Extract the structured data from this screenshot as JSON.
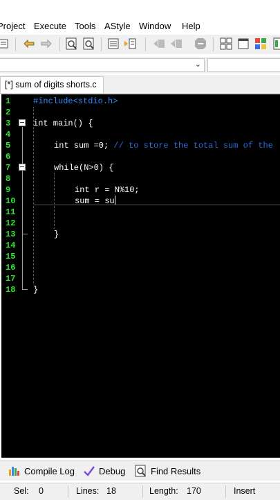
{
  "menu": [
    "Project",
    "Execute",
    "Tools",
    "AStyle",
    "Window",
    "Help"
  ],
  "toolbar_icons": [
    "print-icon",
    "undo-icon",
    "redo-icon",
    "find-icon",
    "replace-icon",
    "goto-icon",
    "indent-icon",
    "bookmark-back-icon",
    "bookmark-fwd-icon",
    "stop-icon",
    "grid-icon",
    "window-icon",
    "tiles-icon",
    "layout-icon"
  ],
  "tab": {
    "label": "[*] sum of digits shorts.c"
  },
  "code_lines": [
    {
      "n": "1",
      "text": "#include<stdio.h>"
    },
    {
      "n": "2",
      "text": ""
    },
    {
      "n": "3",
      "text": "int main() {"
    },
    {
      "n": "4",
      "text": ""
    },
    {
      "n": "5",
      "text": "int sum =0;",
      "comment": "// to store the total sum of the"
    },
    {
      "n": "6",
      "text": ""
    },
    {
      "n": "7",
      "text": "while(N>0) {"
    },
    {
      "n": "8",
      "text": ""
    },
    {
      "n": "9",
      "text": "int r = N%10;"
    },
    {
      "n": "10",
      "text": "sum = su"
    },
    {
      "n": "11",
      "text": ""
    },
    {
      "n": "12",
      "text": ""
    },
    {
      "n": "13",
      "text": "}"
    },
    {
      "n": "14",
      "text": ""
    },
    {
      "n": "15",
      "text": ""
    },
    {
      "n": "16",
      "text": ""
    },
    {
      "n": "17",
      "text": ""
    },
    {
      "n": "18",
      "text": "}"
    }
  ],
  "bottom_tabs": [
    {
      "label": "Compile Log",
      "icon": "compile-log-icon"
    },
    {
      "label": "Debug",
      "icon": "debug-icon"
    },
    {
      "label": "Find Results",
      "icon": "find-results-icon"
    }
  ],
  "status": {
    "sel_label": "Sel:",
    "sel_value": "0",
    "lines_label": "Lines:",
    "lines_value": "18",
    "length_label": "Length:",
    "length_value": "170",
    "mode": "Insert"
  },
  "colors": {
    "editor_bg": "#000000",
    "line_numbers": "#2ee82e",
    "preprocessor": "#2e8bff",
    "comment": "#2e6ad8"
  }
}
